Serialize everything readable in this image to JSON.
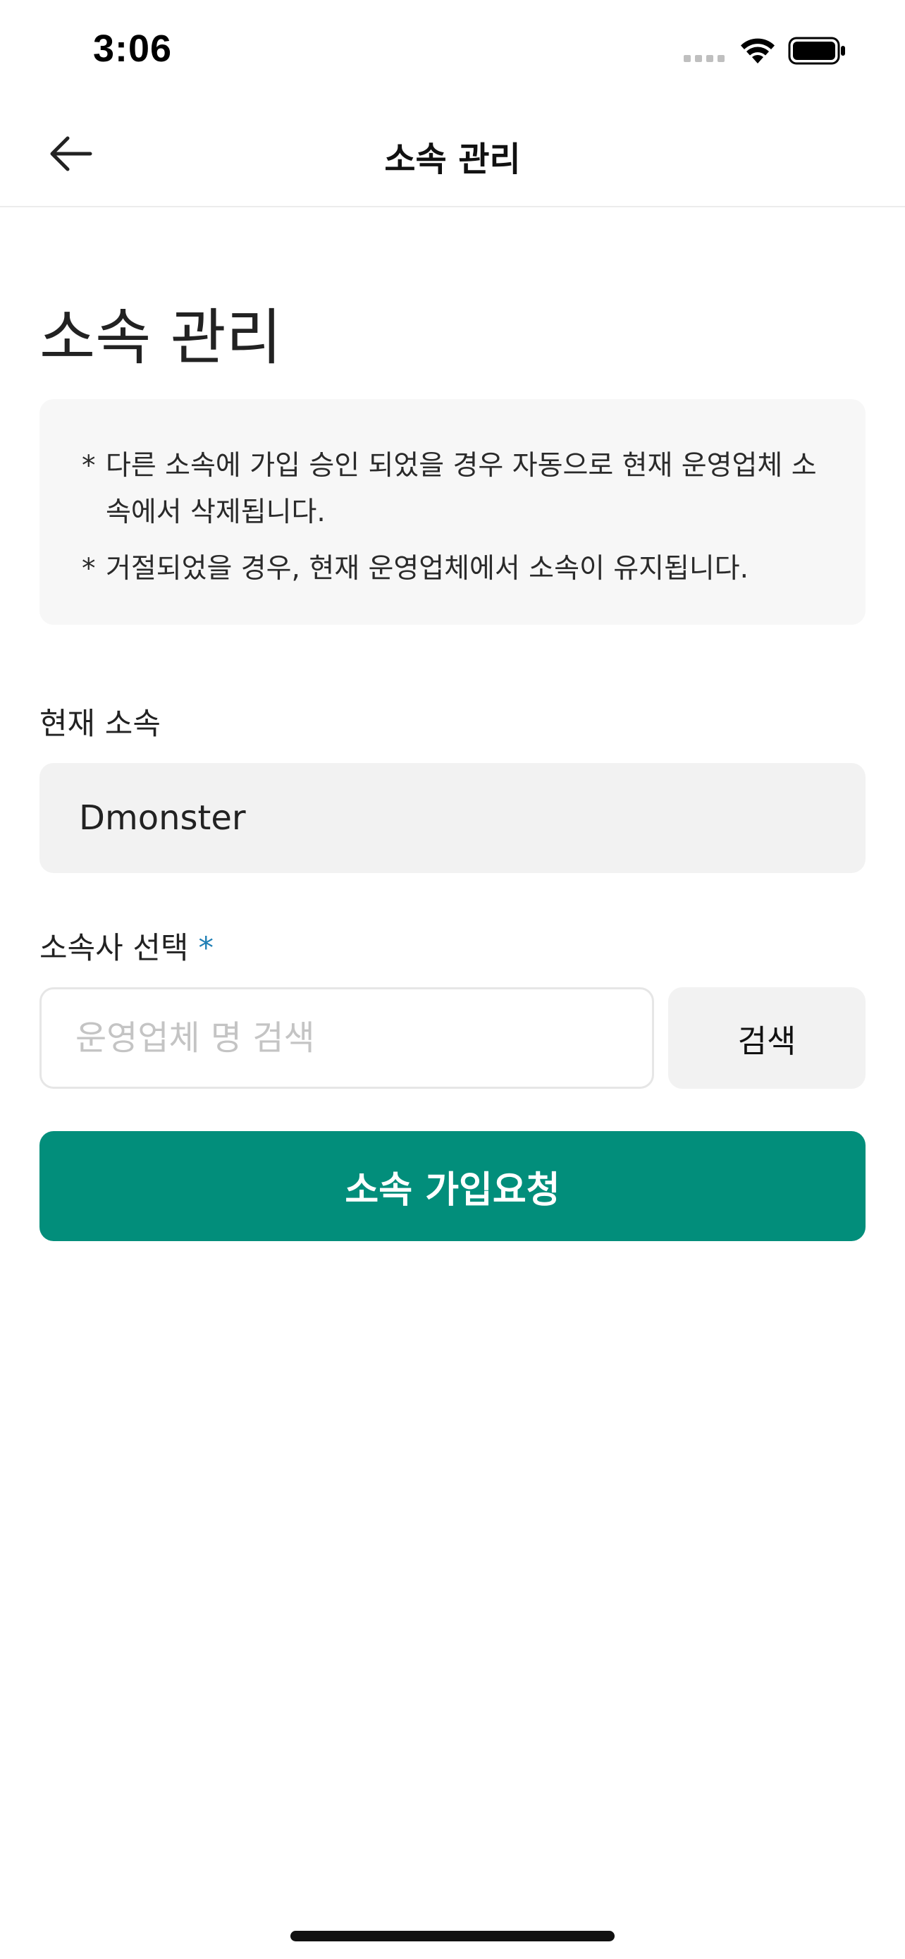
{
  "status_bar": {
    "time": "3:06"
  },
  "header": {
    "title": "소속 관리",
    "back_icon": "arrow-left-icon"
  },
  "page": {
    "title": "소속 관리"
  },
  "notice": {
    "items": [
      {
        "bullet": "*",
        "text": "다른 소속에 가입 승인 되었을 경우 자동으로 현재 운영업체 소속에서 삭제됩니다."
      },
      {
        "bullet": "*",
        "text": "거절되었을 경우, 현재 운영업체에서 소속이 유지됩니다."
      }
    ]
  },
  "current_affiliation": {
    "label": "현재 소속",
    "value": "Dmonster"
  },
  "affiliation_select": {
    "label": "소속사 선택",
    "required_mark": "*",
    "search_placeholder": "운영업체 명 검색",
    "search_button": "검색"
  },
  "submit": {
    "label": "소속 가입요청"
  },
  "colors": {
    "primary": "#028e7b",
    "required": "#1f7fb5",
    "field_bg": "#f2f2f2",
    "notice_bg": "#f7f7f7"
  }
}
